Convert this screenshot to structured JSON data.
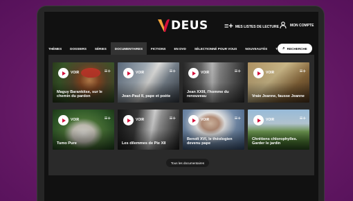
{
  "brand": {
    "name": "DEUS",
    "accent": "#d3103a",
    "accent2": "#f2a33a",
    "background": "#6b1e6c"
  },
  "header": {
    "lists_label": "MES LISTES DE LECTURE",
    "lists_icon": "playlist-add-icon",
    "account_label": "MON COMPTE",
    "account_icon": "user-icon"
  },
  "nav": {
    "items": [
      "THÈMES",
      "DOSSIERS",
      "SÉRIES",
      "DOCUMENTAIRES",
      "FICTIONS",
      "EN DVD",
      "SÉLECTIONNÉ POUR VOUS",
      "NOUVEAUTÉS",
      "TENDANCES"
    ],
    "active": "DOCUMENTAIRES",
    "search_label": "RECHERCHE",
    "search_icon": "search-icon"
  },
  "cards": [
    {
      "title": "Maguy Barankitse, sur le chemin du pardon",
      "voir": "VOIR"
    },
    {
      "title": "Jean-Paul II, pape et poète",
      "voir": "VOIR"
    },
    {
      "title": "Jean XXIII, l'homme du renouveau",
      "voir": "VOIR"
    },
    {
      "title": "Vraie Jeanne, fausse Jeanne",
      "voir": "VOIR"
    },
    {
      "title": "Tumo Pure",
      "voir": "VOIR"
    },
    {
      "title": "Les dilemmes de Pie XII",
      "voir": "VOIR"
    },
    {
      "title": "Benoît XVI, le théologien devenu pape",
      "voir": "VOIR"
    },
    {
      "title": "Chrétiens chlorophylles. Garder le jardin",
      "voir": "VOIR"
    }
  ],
  "footer": {
    "all_label": "Tous les documentaires"
  }
}
